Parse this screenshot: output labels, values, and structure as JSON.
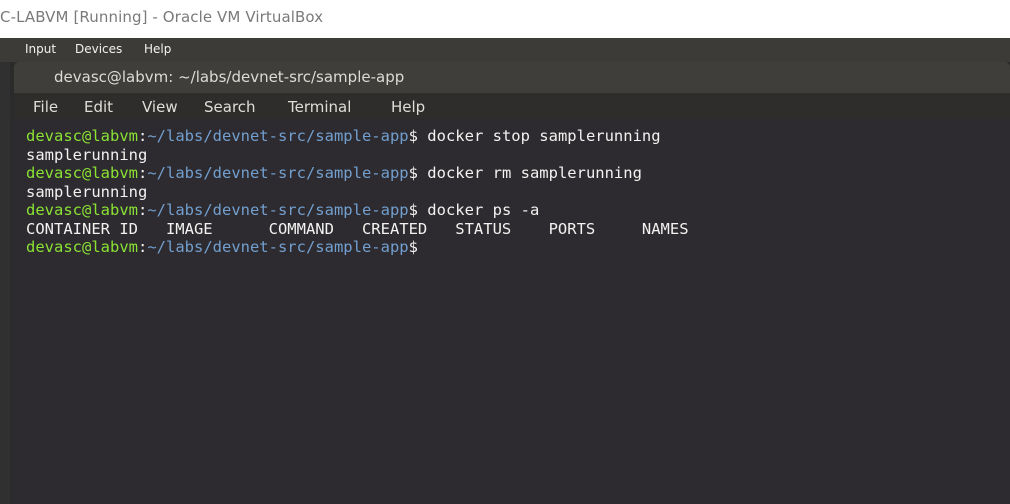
{
  "window": {
    "title": "C-LABVM [Running] - Oracle VM VirtualBox"
  },
  "vbox_menu": [
    "Input",
    "Devices",
    "Help"
  ],
  "terminal": {
    "title": "devasc@labvm: ~/labs/devnet-src/sample-app",
    "menu": [
      "File",
      "Edit",
      "View",
      "Search",
      "Terminal",
      "Help"
    ],
    "prompt_user": "devasc@labvm",
    "prompt_sep": ":",
    "prompt_path": "~/labs/devnet-src/sample-app",
    "prompt_end": "$",
    "lines": [
      {
        "type": "cmd",
        "text": " docker stop samplerunning"
      },
      {
        "type": "out",
        "text": "samplerunning"
      },
      {
        "type": "cmd",
        "text": " docker rm samplerunning"
      },
      {
        "type": "out",
        "text": "samplerunning"
      },
      {
        "type": "cmd",
        "text": " docker ps -a"
      },
      {
        "type": "out",
        "text": "CONTAINER ID   IMAGE      COMMAND   CREATED   STATUS    PORTS     NAMES"
      },
      {
        "type": "cmd",
        "text": ""
      }
    ]
  },
  "colors": {
    "prompt_user": "#8ae234",
    "prompt_path": "#729fcf",
    "terminal_bg": "#2d2b2f"
  }
}
